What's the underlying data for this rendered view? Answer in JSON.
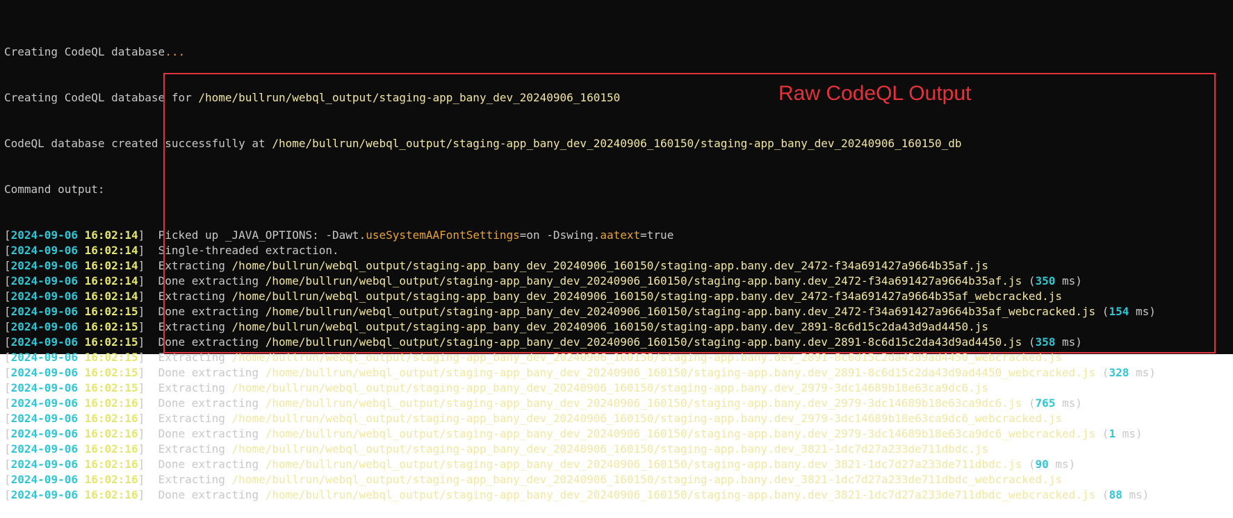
{
  "header_lines": {
    "creating": "Creating CodeQL database",
    "creating_dots": "...",
    "creating_for_prefix": "Creating CodeQL database for ",
    "creating_for_path": "/home/bullrun/webql_output/staging-app_bany_dev_20240906_160150",
    "created_prefix": "CodeQL database created successfully at ",
    "created_path": "/home/bullrun/webql_output/staging-app_bany_dev_20240906_160150/staging-app_bany_dev_20240906_160150_db",
    "command_output": "Command output:"
  },
  "annotation": "Raw CodeQL Output",
  "java_line": {
    "prefix": "Picked up _JAVA_OPTIONS: -Dawt.",
    "key1": "useSystemAAFontSettings",
    "mid": "=on -Dswing.",
    "key2": "aatext",
    "suffix": "=true"
  },
  "log_rows": [
    {
      "date": "2024-09-06",
      "time": "16:02:14",
      "kind": "java"
    },
    {
      "date": "2024-09-06",
      "time": "16:02:14",
      "kind": "plain",
      "text": "Single-threaded extraction."
    },
    {
      "date": "2024-09-06",
      "time": "16:02:14",
      "kind": "extract",
      "verb": "Extracting ",
      "path": "/home/bullrun/webql_output/staging-app_bany_dev_20240906_160150/staging-app.bany.dev_2472-f34a691427a9664b35af.js"
    },
    {
      "date": "2024-09-06",
      "time": "16:02:14",
      "kind": "done",
      "verb": "Done extracting ",
      "path": "/home/bullrun/webql_output/staging-app_bany_dev_20240906_160150/staging-app.bany.dev_2472-f34a691427a9664b35af.js",
      "ms": "350"
    },
    {
      "date": "2024-09-06",
      "time": "16:02:14",
      "kind": "extract",
      "verb": "Extracting ",
      "path": "/home/bullrun/webql_output/staging-app_bany_dev_20240906_160150/staging-app.bany.dev_2472-f34a691427a9664b35af_webcracked.js"
    },
    {
      "date": "2024-09-06",
      "time": "16:02:15",
      "kind": "done",
      "verb": "Done extracting ",
      "path": "/home/bullrun/webql_output/staging-app_bany_dev_20240906_160150/staging-app.bany.dev_2472-f34a691427a9664b35af_webcracked.js",
      "ms": "154"
    },
    {
      "date": "2024-09-06",
      "time": "16:02:15",
      "kind": "extract",
      "verb": "Extracting ",
      "path": "/home/bullrun/webql_output/staging-app_bany_dev_20240906_160150/staging-app.bany.dev_2891-8c6d15c2da43d9ad4450.js"
    },
    {
      "date": "2024-09-06",
      "time": "16:02:15",
      "kind": "done",
      "verb": "Done extracting ",
      "path": "/home/bullrun/webql_output/staging-app_bany_dev_20240906_160150/staging-app.bany.dev_2891-8c6d15c2da43d9ad4450.js",
      "ms": "358"
    },
    {
      "date": "2024-09-06",
      "time": "16:02:15",
      "kind": "extract",
      "verb": "Extracting ",
      "path": "/home/bullrun/webql_output/staging-app_bany_dev_20240906_160150/staging-app.bany.dev_2891-8c6d15c2da43d9ad4450_webcracked.js"
    },
    {
      "date": "2024-09-06",
      "time": "16:02:15",
      "kind": "done",
      "verb": "Done extracting ",
      "path": "/home/bullrun/webql_output/staging-app_bany_dev_20240906_160150/staging-app.bany.dev_2891-8c6d15c2da43d9ad4450_webcracked.js",
      "ms": "328"
    },
    {
      "date": "2024-09-06",
      "time": "16:02:15",
      "kind": "extract",
      "verb": "Extracting ",
      "path": "/home/bullrun/webql_output/staging-app_bany_dev_20240906_160150/staging-app.bany.dev_2979-3dc14689b18e63ca9dc6.js"
    },
    {
      "date": "2024-09-06",
      "time": "16:02:16",
      "kind": "done",
      "verb": "Done extracting ",
      "path": "/home/bullrun/webql_output/staging-app_bany_dev_20240906_160150/staging-app.bany.dev_2979-3dc14689b18e63ca9dc6.js",
      "ms": "765"
    },
    {
      "date": "2024-09-06",
      "time": "16:02:16",
      "kind": "extract",
      "verb": "Extracting ",
      "path": "/home/bullrun/webql_output/staging-app_bany_dev_20240906_160150/staging-app.bany.dev_2979-3dc14689b18e63ca9dc6_webcracked.js"
    },
    {
      "date": "2024-09-06",
      "time": "16:02:16",
      "kind": "done",
      "verb": "Done extracting ",
      "path": "/home/bullrun/webql_output/staging-app_bany_dev_20240906_160150/staging-app.bany.dev_2979-3dc14689b18e63ca9dc6_webcracked.js",
      "ms": "1"
    },
    {
      "date": "2024-09-06",
      "time": "16:02:16",
      "kind": "extract",
      "verb": "Extracting ",
      "path": "/home/bullrun/webql_output/staging-app_bany_dev_20240906_160150/staging-app.bany.dev_3821-1dc7d27a233de711dbdc.js"
    },
    {
      "date": "2024-09-06",
      "time": "16:02:16",
      "kind": "done",
      "verb": "Done extracting ",
      "path": "/home/bullrun/webql_output/staging-app_bany_dev_20240906_160150/staging-app.bany.dev_3821-1dc7d27a233de711dbdc.js",
      "ms": "90"
    },
    {
      "date": "2024-09-06",
      "time": "16:02:16",
      "kind": "extract",
      "verb": "Extracting ",
      "path": "/home/bullrun/webql_output/staging-app_bany_dev_20240906_160150/staging-app.bany.dev_3821-1dc7d27a233de711dbdc_webcracked.js"
    },
    {
      "date": "2024-09-06",
      "time": "16:02:16",
      "kind": "done",
      "verb": "Done extracting ",
      "path": "/home/bullrun/webql_output/staging-app_bany_dev_20240906_160150/staging-app.bany.dev_3821-1dc7d27a233de711dbdc_webcracked.js",
      "ms": "88"
    }
  ],
  "ms_unit": "ms",
  "colors": {
    "background": "#0c0c0c",
    "timestamp_date": "#2ec7d6",
    "timestamp_time": "#e6e66b",
    "path": "#f2e7a0",
    "highlight": "#e1333b"
  }
}
